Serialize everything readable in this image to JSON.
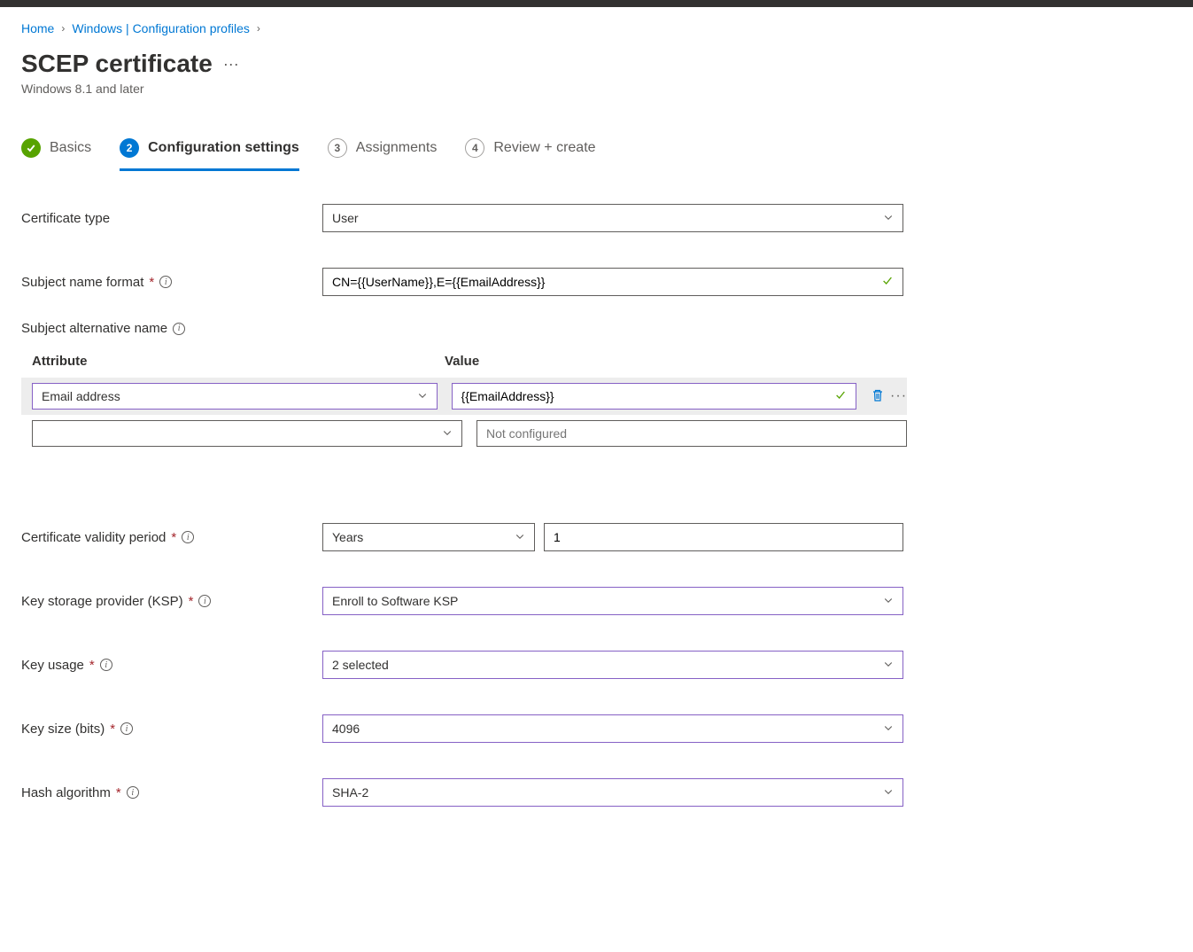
{
  "breadcrumb": {
    "home": "Home",
    "windows": "Windows | Configuration profiles"
  },
  "page": {
    "title": "SCEP certificate",
    "subtitle": "Windows 8.1 and later"
  },
  "stepper": {
    "step1": "Basics",
    "step2_num": "2",
    "step2": "Configuration settings",
    "step3_num": "3",
    "step3": "Assignments",
    "step4_num": "4",
    "step4": "Review + create"
  },
  "fields": {
    "cert_type": {
      "label": "Certificate type",
      "value": "User"
    },
    "subject_name": {
      "label": "Subject name format",
      "value": "CN={{UserName}},E={{EmailAddress}}"
    },
    "san": {
      "label": "Subject alternative name"
    },
    "validity": {
      "label": "Certificate validity period",
      "unit": "Years",
      "value": "1"
    },
    "ksp": {
      "label": "Key storage provider (KSP)",
      "value": "Enroll to Software KSP"
    },
    "key_usage": {
      "label": "Key usage",
      "value": "2 selected"
    },
    "key_size": {
      "label": "Key size (bits)",
      "value": "4096"
    },
    "hash": {
      "label": "Hash algorithm",
      "value": "SHA-2"
    }
  },
  "san_table": {
    "header_attr": "Attribute",
    "header_value": "Value",
    "row1": {
      "attr": "Email address",
      "value": "{{EmailAddress}}"
    },
    "empty_placeholder": "Not configured"
  }
}
